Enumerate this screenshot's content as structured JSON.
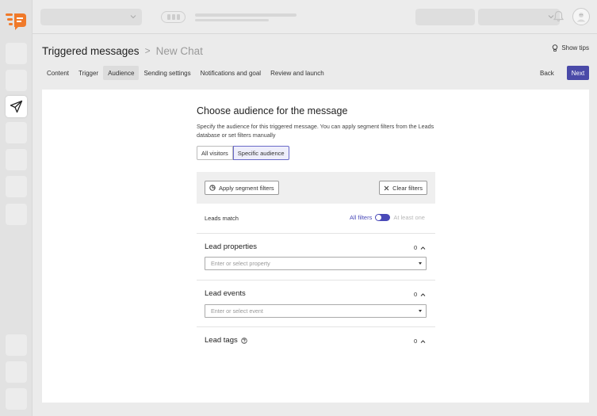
{
  "header": {
    "title": "Triggered messages",
    "separator": ">",
    "subtitle": "New Chat",
    "show_tips": "Show tips"
  },
  "tabs": [
    {
      "label": "Content",
      "active": false
    },
    {
      "label": "Trigger",
      "active": false
    },
    {
      "label": "Audience",
      "active": true
    },
    {
      "label": "Sending settings",
      "active": false
    },
    {
      "label": "Notifications and goal",
      "active": false
    },
    {
      "label": "Review and launch",
      "active": false
    }
  ],
  "actions": {
    "back": "Back",
    "next": "Next"
  },
  "audience": {
    "heading": "Choose audience for the message",
    "description": "Specify the audience for this triggered message. You can apply segment filters from the Leads database or set filters manually",
    "options": [
      "All visitors",
      "Specific audience"
    ],
    "selected_option": "Specific audience"
  },
  "filters": {
    "apply_label": "Apply segment filters",
    "clear_label": "Clear filters",
    "leads_match_label": "Leads match",
    "match_all": "All filters",
    "match_one": "At least one"
  },
  "sections": {
    "properties": {
      "title": "Lead properties",
      "count": "0",
      "placeholder": "Enter or select property"
    },
    "events": {
      "title": "Lead events",
      "count": "0",
      "placeholder": "Enter or select event"
    },
    "tags": {
      "title": "Lead tags",
      "count": "0"
    }
  },
  "colors": {
    "accent": "#4a4aa8",
    "logo": "#f07a2a",
    "background": "#ebebeb"
  }
}
